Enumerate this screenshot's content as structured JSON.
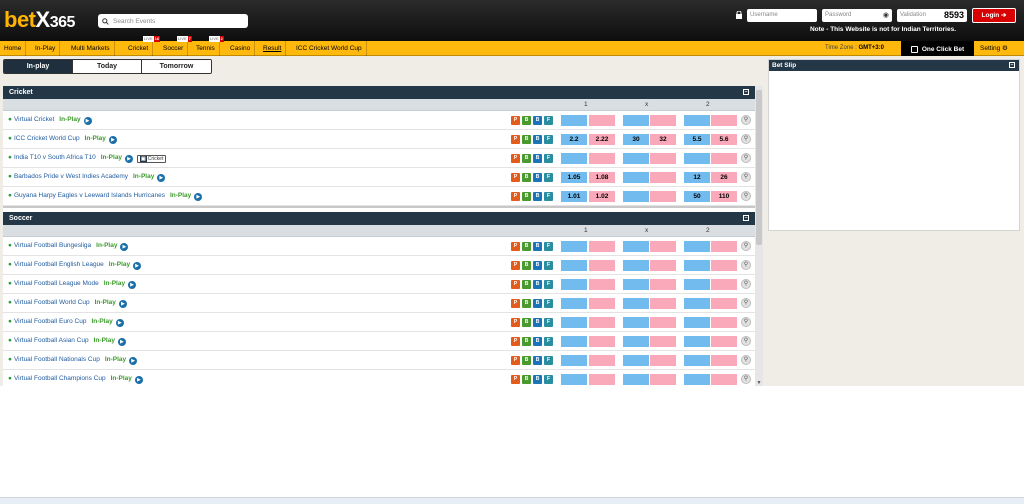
{
  "header": {
    "logo_bet": "bet",
    "logo_x": "X",
    "logo_num": "365",
    "search_placeholder": "Search Events",
    "username_placeholder": "Username",
    "password_placeholder": "Password",
    "validation_label": "Validation",
    "validation_code": "8593",
    "login_label": "Login ➔",
    "note": "Note - This Website is not for Indian Territories."
  },
  "nav": {
    "items": [
      "Home",
      "In-Play",
      "Multi Markets",
      "Cricket",
      "Soccer",
      "Tennis",
      "Casino",
      "Result",
      "ICC Cricket World Cup"
    ],
    "badges": {
      "cricket": {
        "live": "LIVE",
        "count": "16"
      },
      "soccer": {
        "live": "LIVE",
        "count": "7"
      },
      "tennis": {
        "live": "LIVE",
        "count": "2"
      }
    },
    "timezone_label": "Time Zone :",
    "timezone_value": "GMT+3:0",
    "one_click": "One Click Bet",
    "setting": "Setting ⚙"
  },
  "day_tabs": [
    "In-play",
    "Today",
    "Tomorrow"
  ],
  "col_labels": [
    "1",
    "x",
    "2"
  ],
  "cricket": {
    "title": "Cricket",
    "rows": [
      {
        "name": "Virtual Cricket",
        "inplay": "In-Play",
        "tag": "",
        "odds": [
          "",
          "",
          "",
          "",
          "",
          ""
        ]
      },
      {
        "name": "ICC Cricket World Cup",
        "inplay": "In-Play",
        "tag": "",
        "odds": [
          "2.2",
          "2.22",
          "30",
          "32",
          "5.5",
          "5.6"
        ]
      },
      {
        "name": "India T10 v South Africa T10",
        "inplay": "In-Play",
        "tag": "Cricket",
        "odds": [
          "",
          "",
          "",
          "",
          "",
          ""
        ]
      },
      {
        "name": "Barbados Pride v West Indies Academy",
        "inplay": "In-Play",
        "tag": "",
        "odds": [
          "1.05",
          "1.08",
          "",
          "",
          "12",
          "26"
        ]
      },
      {
        "name": "Guyana Harpy Eagles v Leeward Islands Hurricanes",
        "inplay": "In-Play",
        "tag": "",
        "odds": [
          "1.01",
          "1.02",
          "",
          "",
          "50",
          "110"
        ]
      }
    ]
  },
  "soccer": {
    "title": "Soccer",
    "rows": [
      {
        "name": "Virtual Football Bungesliga",
        "inplay": "In-Play"
      },
      {
        "name": "Virtual Football English League",
        "inplay": "In-Play"
      },
      {
        "name": "Virtual Football League Mode",
        "inplay": "In-Play"
      },
      {
        "name": "Virtual Football World Cup",
        "inplay": "In-Play"
      },
      {
        "name": "Virtual Football Euro Cup",
        "inplay": "In-Play"
      },
      {
        "name": "Virtual Football Asian Cup",
        "inplay": "In-Play"
      },
      {
        "name": "Virtual Football Nationals Cup",
        "inplay": "In-Play"
      },
      {
        "name": "Virtual Football Champions Cup",
        "inplay": "In-Play"
      }
    ]
  },
  "market_icons": [
    "P",
    "B",
    "B",
    "F"
  ],
  "betslip": {
    "title": "Bet Slip"
  }
}
